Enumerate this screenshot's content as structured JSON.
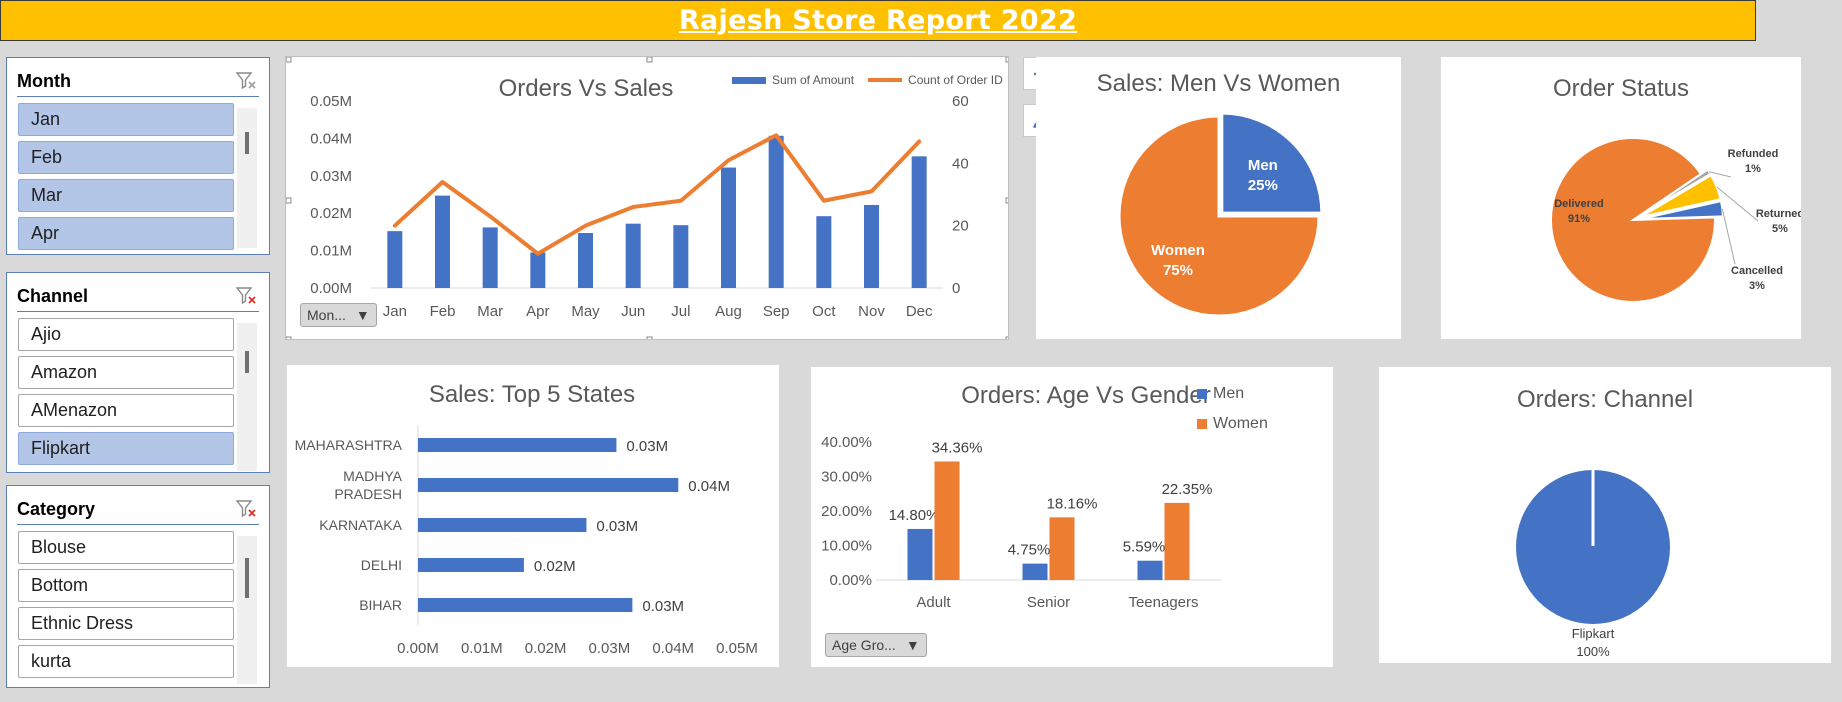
{
  "report_title": "Rajesh Store Report 2022",
  "colors": {
    "blue": "#4472c4",
    "orange": "#ed7d31",
    "gray": "#a5a5a5",
    "gold": "#ffc000",
    "banner": "#ffc000",
    "selected": "#b4c6e7"
  },
  "slicers": [
    {
      "title": "Month",
      "icon": "clear-filter-icon",
      "items": [
        {
          "label": "Jan",
          "selected": true
        },
        {
          "label": "Feb",
          "selected": true
        },
        {
          "label": "Mar",
          "selected": true
        },
        {
          "label": "Apr",
          "selected": true
        }
      ]
    },
    {
      "title": "Channel",
      "icon": "clear-filter-icon",
      "items": [
        {
          "label": "Ajio",
          "selected": false
        },
        {
          "label": "Amazon",
          "selected": false
        },
        {
          "label": "AMenazon",
          "selected": false
        },
        {
          "label": "Flipkart",
          "selected": true
        }
      ]
    },
    {
      "title": "Category",
      "icon": "clear-filter-icon",
      "items": [
        {
          "label": "Blouse",
          "selected": false
        },
        {
          "label": "Bottom",
          "selected": false
        },
        {
          "label": "Ethnic Dress",
          "selected": false
        },
        {
          "label": "kurta",
          "selected": false
        }
      ]
    }
  ],
  "chart_tools": [
    {
      "name": "add-element-button",
      "icon": "plus-icon"
    },
    {
      "name": "chart-style-button",
      "icon": "paintbrush-icon"
    }
  ],
  "field_buttons": {
    "orders_sales": "Mon...",
    "age_gender": "Age Gro..."
  },
  "chart_data": [
    {
      "type": "bar",
      "title": "Orders Vs Sales",
      "categories": [
        "Jan",
        "Feb",
        "Mar",
        "Apr",
        "May",
        "Jun",
        "Jul",
        "Aug",
        "Sep",
        "Oct",
        "Nov",
        "Dec"
      ],
      "series": [
        {
          "name": "Sum of Amount",
          "kind": "bar",
          "axis": "left",
          "values": [
            0.0152,
            0.0247,
            0.0162,
            0.0095,
            0.0147,
            0.0172,
            0.0168,
            0.0322,
            0.0407,
            0.0192,
            0.0222,
            0.0352
          ]
        },
        {
          "name": "Count of Order ID",
          "kind": "line",
          "axis": "right",
          "values": [
            20,
            34,
            23,
            11,
            20,
            26,
            28,
            41,
            49,
            28,
            31,
            47
          ]
        }
      ],
      "ylim": [
        0,
        0.05
      ],
      "y_ticks": [
        "0.00M",
        "0.01M",
        "0.02M",
        "0.03M",
        "0.04M",
        "0.05M"
      ],
      "y2lim": [
        0,
        60
      ],
      "y2_ticks": [
        "0",
        "20",
        "40",
        "60"
      ],
      "legend": "top-right",
      "grid": false
    },
    {
      "type": "pie",
      "title": "Sales: Men Vs Women",
      "slices": [
        {
          "label": "Men",
          "value": 25,
          "text": "25%",
          "color": "#4472c4"
        },
        {
          "label": "Women",
          "value": 75,
          "text": "75%",
          "color": "#ed7d31"
        }
      ]
    },
    {
      "type": "pie",
      "title": "Order Status",
      "slices": [
        {
          "label": "Delivered",
          "value": 91,
          "text": "91%",
          "color": "#ed7d31"
        },
        {
          "label": "Refunded",
          "value": 1,
          "text": "1%",
          "color": "#a5a5a5"
        },
        {
          "label": "Returned",
          "value": 5,
          "text": "5%",
          "color": "#ffc000"
        },
        {
          "label": "Cancelled",
          "value": 3,
          "text": "3%",
          "color": "#4472c4"
        }
      ]
    },
    {
      "type": "bar",
      "orientation": "horizontal",
      "title": "Sales: Top 5 States",
      "categories": [
        "MAHARASHTRA",
        "MADHYA PRADESH",
        "KARNATAKA",
        "DELHI",
        "BIHAR"
      ],
      "values": [
        0.0311,
        0.0408,
        0.0264,
        0.0166,
        0.0336
      ],
      "data_labels": [
        "0.03M",
        "0.04M",
        "0.03M",
        "0.02M",
        "0.03M"
      ],
      "xlim": [
        0,
        0.05
      ],
      "x_ticks": [
        "0.00M",
        "0.01M",
        "0.02M",
        "0.03M",
        "0.04M",
        "0.05M"
      ],
      "grid": false
    },
    {
      "type": "bar",
      "title": "Orders: Age Vs Gender",
      "categories": [
        "Adult",
        "Senior",
        "Teenagers"
      ],
      "series": [
        {
          "name": "Men",
          "values": [
            14.8,
            4.75,
            5.59
          ],
          "labels": [
            "14.80%",
            "4.75%",
            "5.59%"
          ],
          "color": "#4472c4"
        },
        {
          "name": "Women",
          "values": [
            34.36,
            18.16,
            22.35
          ],
          "labels": [
            "34.36%",
            "18.16%",
            "22.35%"
          ],
          "color": "#ed7d31"
        }
      ],
      "ylim": [
        0,
        40
      ],
      "y_ticks": [
        "0.00%",
        "10.00%",
        "20.00%",
        "30.00%",
        "40.00%"
      ],
      "legend": "top-right",
      "grid": false
    },
    {
      "type": "pie",
      "title": "Orders: Channel",
      "slices": [
        {
          "label": "Flipkart",
          "value": 100,
          "text": "100%",
          "color": "#4472c4"
        }
      ]
    }
  ]
}
